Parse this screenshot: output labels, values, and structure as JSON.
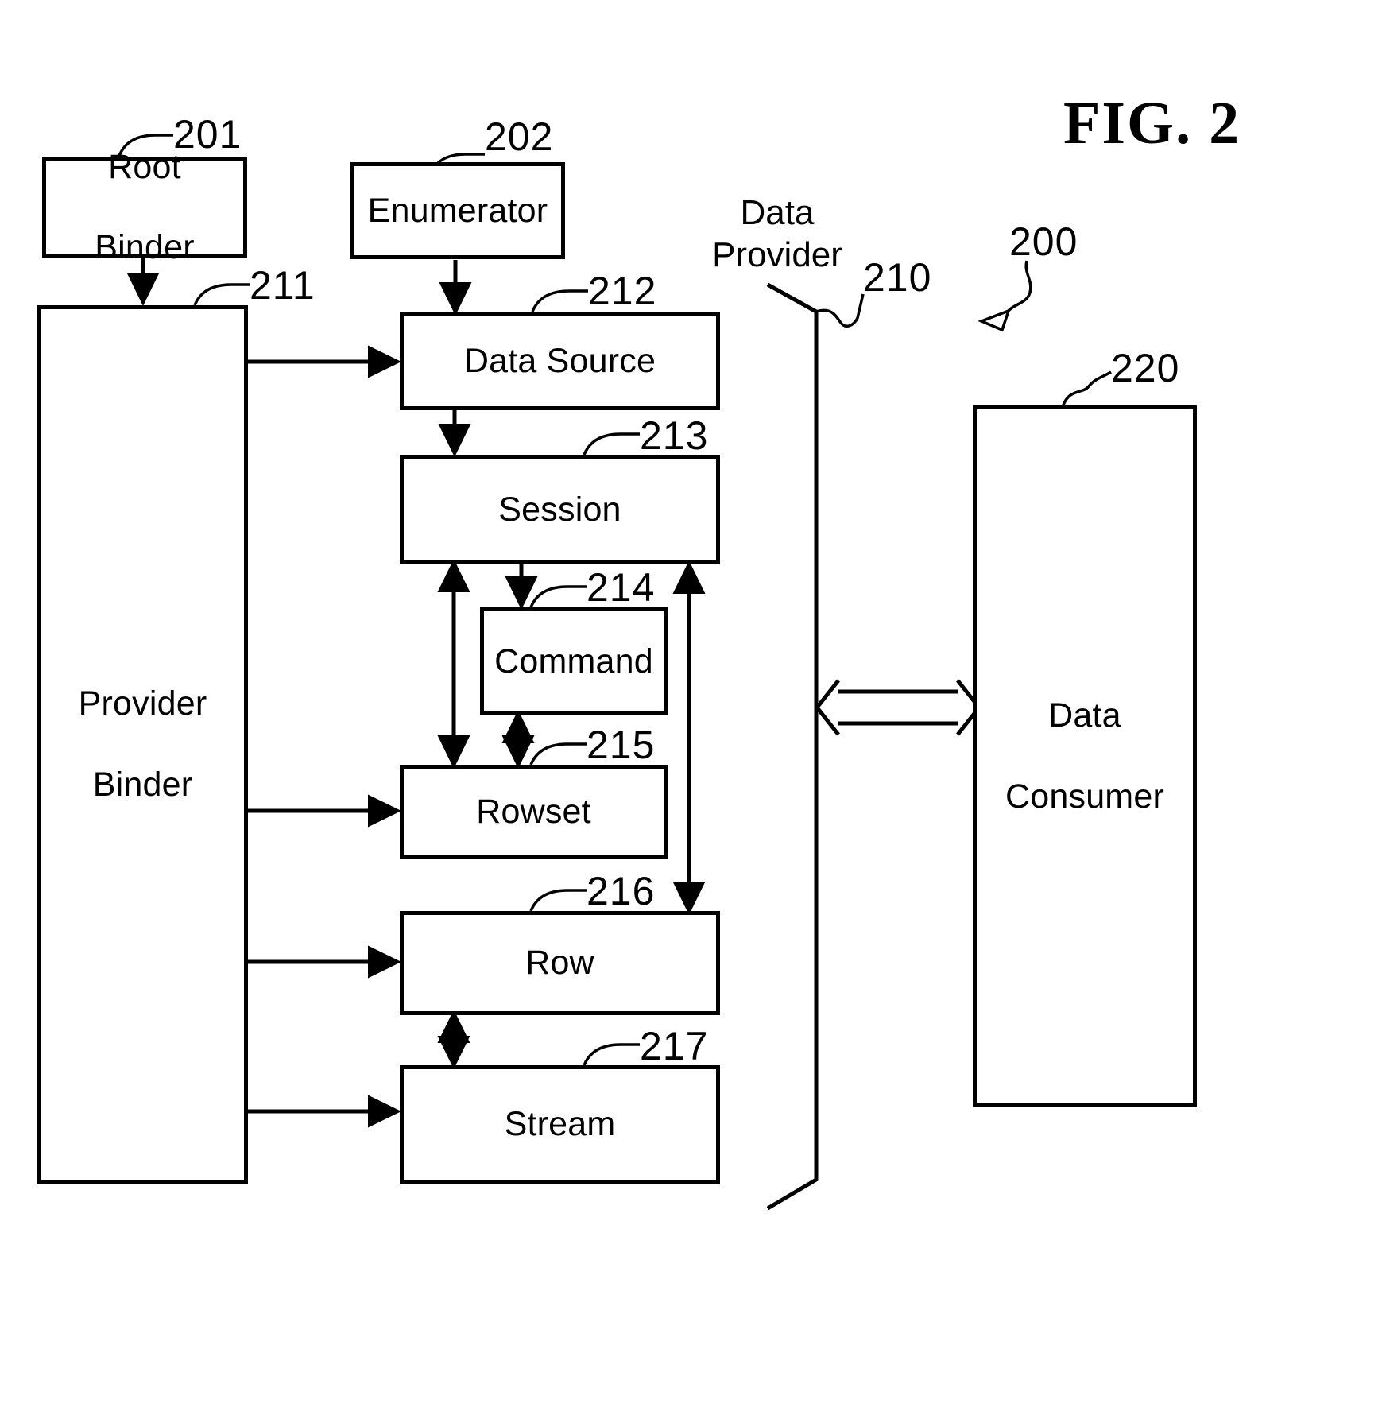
{
  "figure": {
    "title": "FIG. 2",
    "overall_ref": "200"
  },
  "groups": {
    "data_provider": {
      "label_line1": "Data",
      "label_line2": "Provider",
      "ref": "210"
    }
  },
  "boxes": [
    {
      "id": "root-binder",
      "label_line1": "Root",
      "label_line2": "Binder",
      "ref": "201"
    },
    {
      "id": "enumerator",
      "label_line1": "Enumerator",
      "label_line2": "",
      "ref": "202"
    },
    {
      "id": "provider-binder",
      "label_line1": "Provider",
      "label_line2": "Binder",
      "ref": "211"
    },
    {
      "id": "data-source",
      "label_line1": "Data Source",
      "label_line2": "",
      "ref": "212"
    },
    {
      "id": "session",
      "label_line1": "Session",
      "label_line2": "",
      "ref": "213"
    },
    {
      "id": "command",
      "label_line1": "Command",
      "label_line2": "",
      "ref": "214"
    },
    {
      "id": "rowset",
      "label_line1": "Rowset",
      "label_line2": "",
      "ref": "215"
    },
    {
      "id": "row",
      "label_line1": "Row",
      "label_line2": "",
      "ref": "216"
    },
    {
      "id": "stream",
      "label_line1": "Stream",
      "label_line2": "",
      "ref": "217"
    },
    {
      "id": "data-consumer",
      "label_line1": "Data",
      "label_line2": "Consumer",
      "ref": "220"
    }
  ],
  "colors": {
    "ink": "#000000",
    "paper": "#ffffff"
  }
}
